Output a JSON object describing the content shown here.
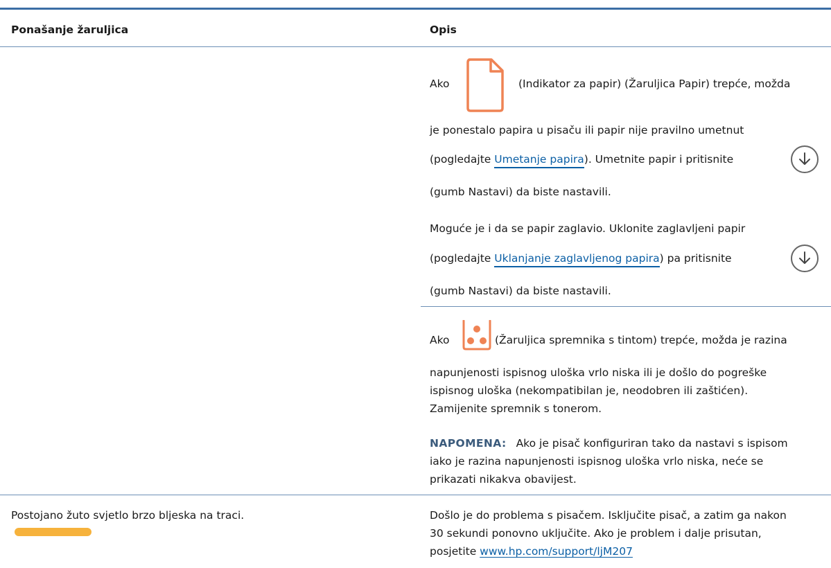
{
  "colors": {
    "header_rule": "#3b6ea5",
    "divider": "#6c8fb5",
    "link": "#0b5fa5",
    "note_label": "#3b5b7c",
    "icon_orange": "#ef8354",
    "bar_amber": "#f6b23c",
    "icon_gray": "#666666"
  },
  "table": {
    "headers": {
      "behavior": "Ponašanje žaruljica",
      "description": "Opis"
    },
    "row1": {
      "paper": {
        "ako": "Ako",
        "paper_icon": "paper-icon",
        "line1_tail": "(Indikator za papir) (Žaruljica Papir) trepće, možda",
        "line2": "je ponestalo papira u pisaču ili papir nije pravilno umetnut",
        "line3_pre": "(pogledajte ",
        "line3_link": "Umetanje papira",
        "line3_post": "). Umetnite papir i pritisnite",
        "resume_icon": "resume-arrow-icon",
        "line4": "(gumb Nastavi) da biste nastavili.",
        "line5": "Moguće je i da se papir zaglavio. Uklonite zaglavljeni papir",
        "line6_pre": "(pogledajte ",
        "line6_link": "Uklanjanje zaglavljenog papira",
        "line6_post": ") pa pritisnite",
        "line7": "(gumb Nastavi) da biste nastavili."
      },
      "toner": {
        "ako": "Ako",
        "toner_icon": "toner-cartridge-icon",
        "line1_tail": "(Žaruljica spremnika s tintom) trepće, možda je razina",
        "line2": "napunjenosti ispisnog uloška vrlo niska ili je došlo do pogreške",
        "line3": "ispisnog uloška (nekompatibilan je, neodobren ili zaštićen).",
        "line4": "Zamijenite spremnik s tonerom.",
        "note_label": "NAPOMENA:",
        "note_line1": "Ako je pisač konfiguriran tako da nastavi s ispisom",
        "note_line2": "iako je razina napunjenosti ispisnog uloška vrlo niska, neće se",
        "note_line3": "prikazati nikakva obavijest."
      }
    },
    "row2": {
      "behavior": "Postojano žuto svjetlo brzo bljeska na traci.",
      "light_bar_icon": "amber-light-bar-icon",
      "desc_line1": "Došlo je do problema s pisačem. Isključite pisač, a zatim ga nakon",
      "desc_line2": "30 sekundi ponovno uključite. Ako je problem i dalje prisutan,",
      "desc_line3_pre": "posjetite ",
      "desc_line3_link": "www.hp.com/support/ljM207"
    }
  }
}
